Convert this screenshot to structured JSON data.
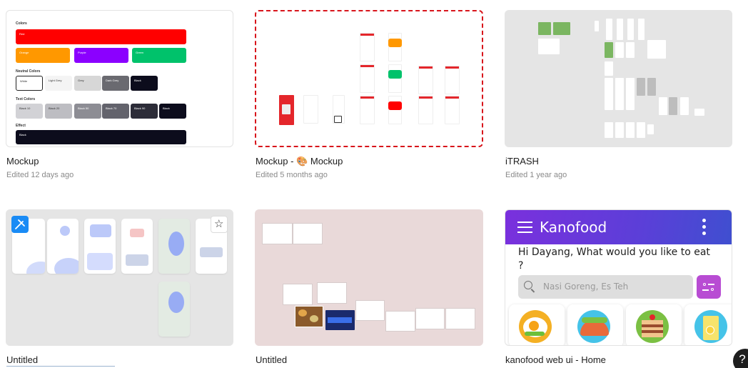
{
  "files": [
    {
      "title": "Mockup",
      "subtitle": "Edited 12 days ago"
    },
    {
      "title": "Mockup - 🎨 Mockup",
      "subtitle": "Edited 5 months ago"
    },
    {
      "title": "iTRASH",
      "subtitle": "Edited 1 year ago"
    },
    {
      "title": "Untitled",
      "subtitle": ""
    },
    {
      "title": "Untitled",
      "subtitle": ""
    },
    {
      "title": "kanofood web ui - Home",
      "subtitle": ""
    }
  ],
  "colors_thumb": {
    "sections": [
      "Colors",
      "Neutral Colors",
      "Text Colors",
      "Effect"
    ],
    "primary": [
      {
        "label": "Red",
        "color": "#ff0000"
      }
    ],
    "accents": [
      {
        "label": "Orange",
        "color": "#ff9800"
      },
      {
        "label": "Purple",
        "color": "#8b00ff"
      },
      {
        "label": "Green",
        "color": "#00c26b"
      }
    ],
    "neutral": [
      {
        "label": "White",
        "color": "#ffffff"
      },
      {
        "label": "Light Grey",
        "color": "#f4f4f4"
      },
      {
        "label": "Grey",
        "color": "#d7d7d7"
      },
      {
        "label": "Dark Grey",
        "color": "#6a6a70"
      },
      {
        "label": "Black",
        "color": "#0c0c1c"
      }
    ],
    "text": [
      {
        "label": "Black 10",
        "color": "#d2d2d6"
      },
      {
        "label": "Black 20",
        "color": "#bdbdc2"
      },
      {
        "label": "Black 50",
        "color": "#8d8d94"
      },
      {
        "label": "Black 70",
        "color": "#63636c"
      },
      {
        "label": "Black 90",
        "color": "#2c2c38"
      },
      {
        "label": "Black",
        "color": "#0c0c1c"
      }
    ],
    "effect": [
      {
        "label": "Black",
        "color": "#0c0c1c"
      }
    ]
  },
  "kanofood": {
    "app_name": "Kanofood",
    "greeting": "Hi Dayang, What would you like to eat ?",
    "search_placeholder": "Nasi Goreng, Es Teh",
    "header_color": "#6a36da",
    "filter_color": "#b84cd3"
  },
  "icons": {
    "help": "?",
    "star": "☆"
  }
}
